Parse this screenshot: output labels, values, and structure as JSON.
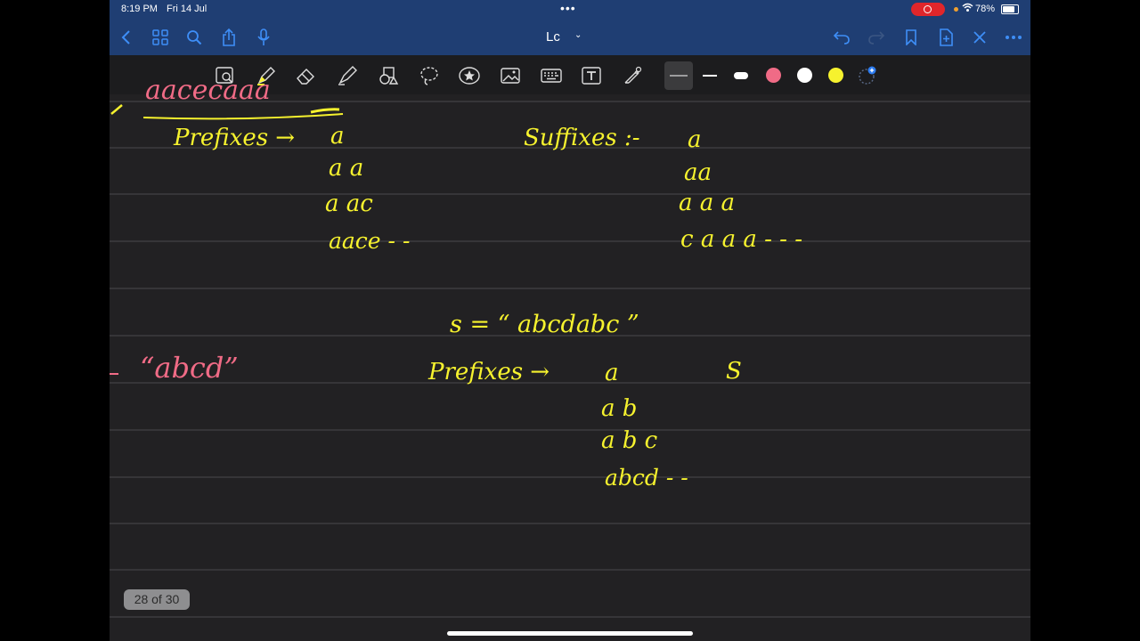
{
  "status": {
    "time": "8:19 PM",
    "date": "Fri 14 Jul",
    "battery": "78%",
    "battery_level": 0.78
  },
  "nav": {
    "title": "Lc"
  },
  "toolbar": {
    "pen_colors": [
      "#f06b86",
      "#ffffff",
      "#f6f22e"
    ]
  },
  "notes": {
    "top_partial": "aacecaaa",
    "prefixes_label": "Prefixes →",
    "prefixes": [
      "a",
      "a a",
      "a ac",
      "aace - -"
    ],
    "suffixes_label": "Suffixes :-",
    "suffixes": [
      "a",
      "aa",
      "a a a",
      "c a a a - - -"
    ],
    "string_def": "s = “ abcdabc ”",
    "left_string": "“abcd”",
    "prefixes2_label": "Prefixes →",
    "prefixes2": [
      "a",
      "a b",
      "a b c",
      "abcd - -"
    ],
    "s_mark": "S"
  },
  "page": {
    "indicator": "28 of 30"
  }
}
